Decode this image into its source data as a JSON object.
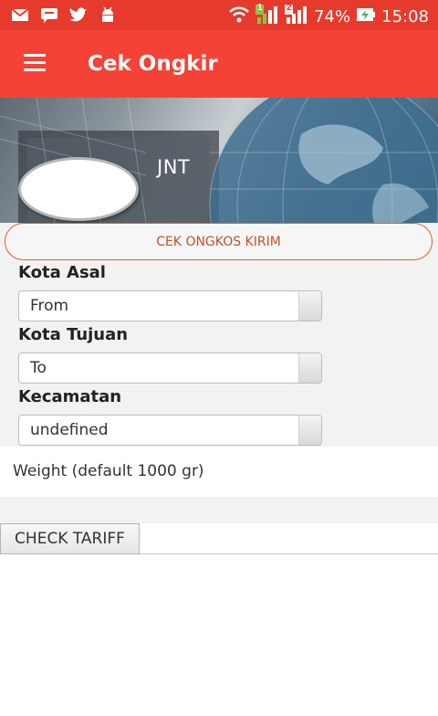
{
  "status_bar": {
    "battery": "74%",
    "time": "15:08",
    "left_icons": [
      "gmail-icon",
      "chat-icon",
      "twitter-icon",
      "android-icon"
    ],
    "right_icons": [
      "wifi-icon",
      "signal-sim1-icon",
      "signal-sim2-icon",
      "battery-charging-icon"
    ],
    "sim1_label": "1",
    "sim2_label": "2"
  },
  "app_bar": {
    "title": "Cek Ongkir",
    "menu_icon": "hamburger-menu-icon"
  },
  "banner": {
    "courier_name": "JNT"
  },
  "form": {
    "check_button": "CEK ONGKOS KIRIM",
    "origin_label": "Kota Asal",
    "origin_value": "From",
    "destination_label": "Kota Tujuan",
    "destination_value": "To",
    "district_label": "Kecamatan",
    "district_value": "undefined",
    "weight_placeholder": "Weight (default 1000 gr)",
    "tariff_button": "CHECK TARIFF"
  },
  "colors": {
    "status_bar": "#e53a2c",
    "app_bar": "#f44336",
    "accent_border": "#d8642e",
    "accent_text": "#c0532a"
  }
}
